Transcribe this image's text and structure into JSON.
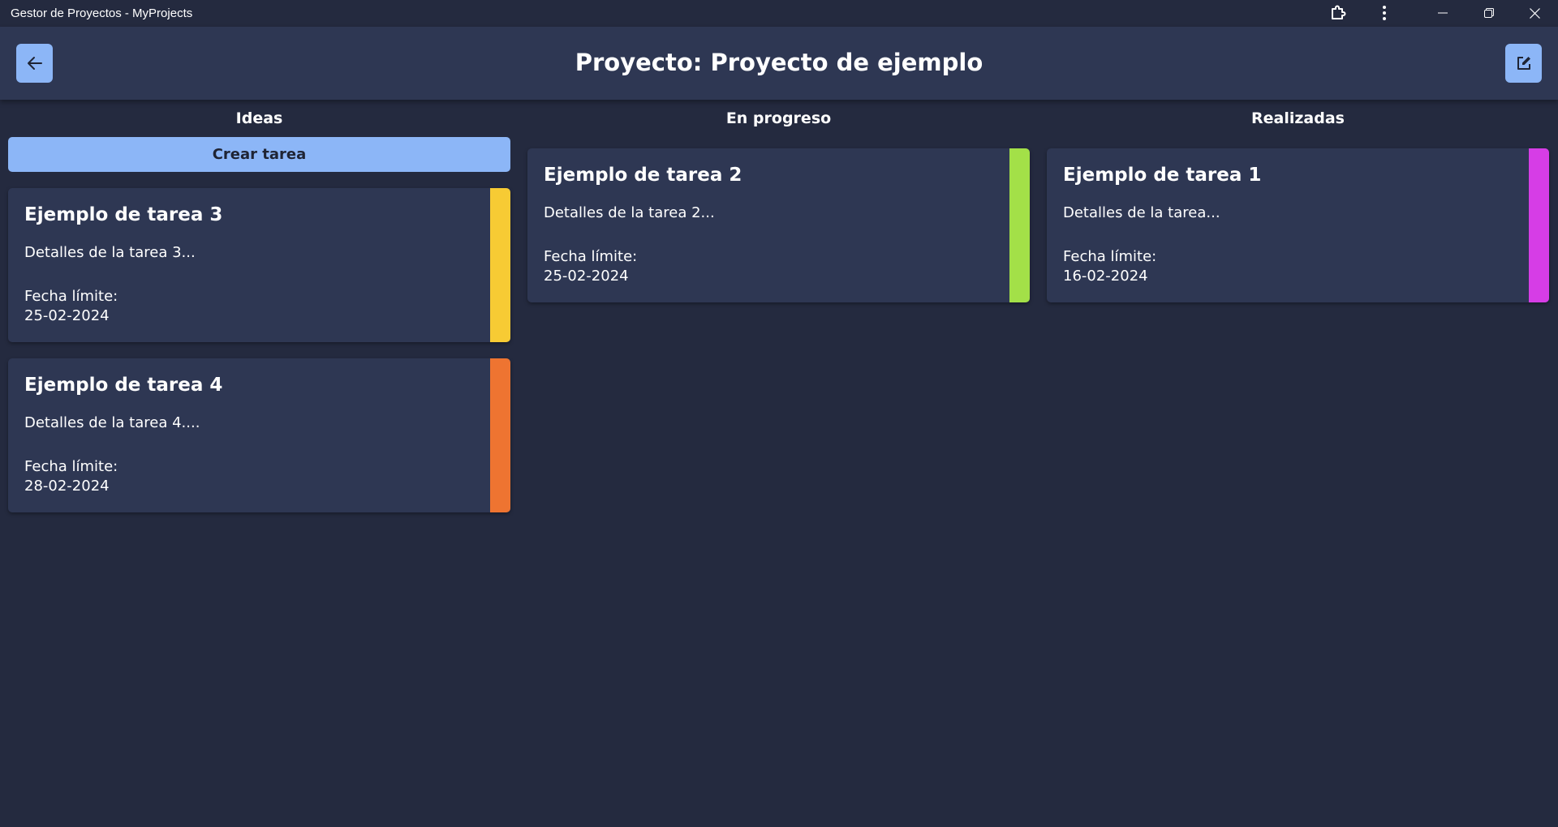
{
  "window": {
    "title": "Gestor de Proyectos - MyProjects",
    "buttons": [
      "extensions-icon",
      "more-icon",
      "minimize-icon",
      "restore-icon",
      "close-icon"
    ]
  },
  "header": {
    "title": "Proyecto: Proyecto de ejemplo",
    "back_icon": "arrow-left-icon",
    "edit_icon": "edit-icon"
  },
  "colors": {
    "background": "#242a3f",
    "surface": "#2e3753",
    "accent": "#8cb6f7"
  },
  "columns": [
    {
      "title": "Ideas",
      "create_label": "Crear tarea",
      "tasks": [
        {
          "title": "Ejemplo de tarea 3",
          "details": "Detalles de la tarea 3...",
          "date_label": "Fecha límite:",
          "date": "25-02-2024",
          "color": "#f7cb34"
        },
        {
          "title": "Ejemplo de tarea 4",
          "details": "Detalles de la tarea 4....",
          "date_label": "Fecha límite:",
          "date": "28-02-2024",
          "color": "#ee7431"
        }
      ]
    },
    {
      "title": "En progreso",
      "tasks": [
        {
          "title": "Ejemplo de tarea 2",
          "details": "Detalles de la tarea 2...",
          "date_label": "Fecha límite:",
          "date": "25-02-2024",
          "color": "#a3e048"
        }
      ]
    },
    {
      "title": "Realizadas",
      "tasks": [
        {
          "title": "Ejemplo de tarea 1",
          "details": "Detalles de la tarea...",
          "date_label": "Fecha límite:",
          "date": "16-02-2024",
          "color": "#d63de6"
        }
      ]
    }
  ]
}
